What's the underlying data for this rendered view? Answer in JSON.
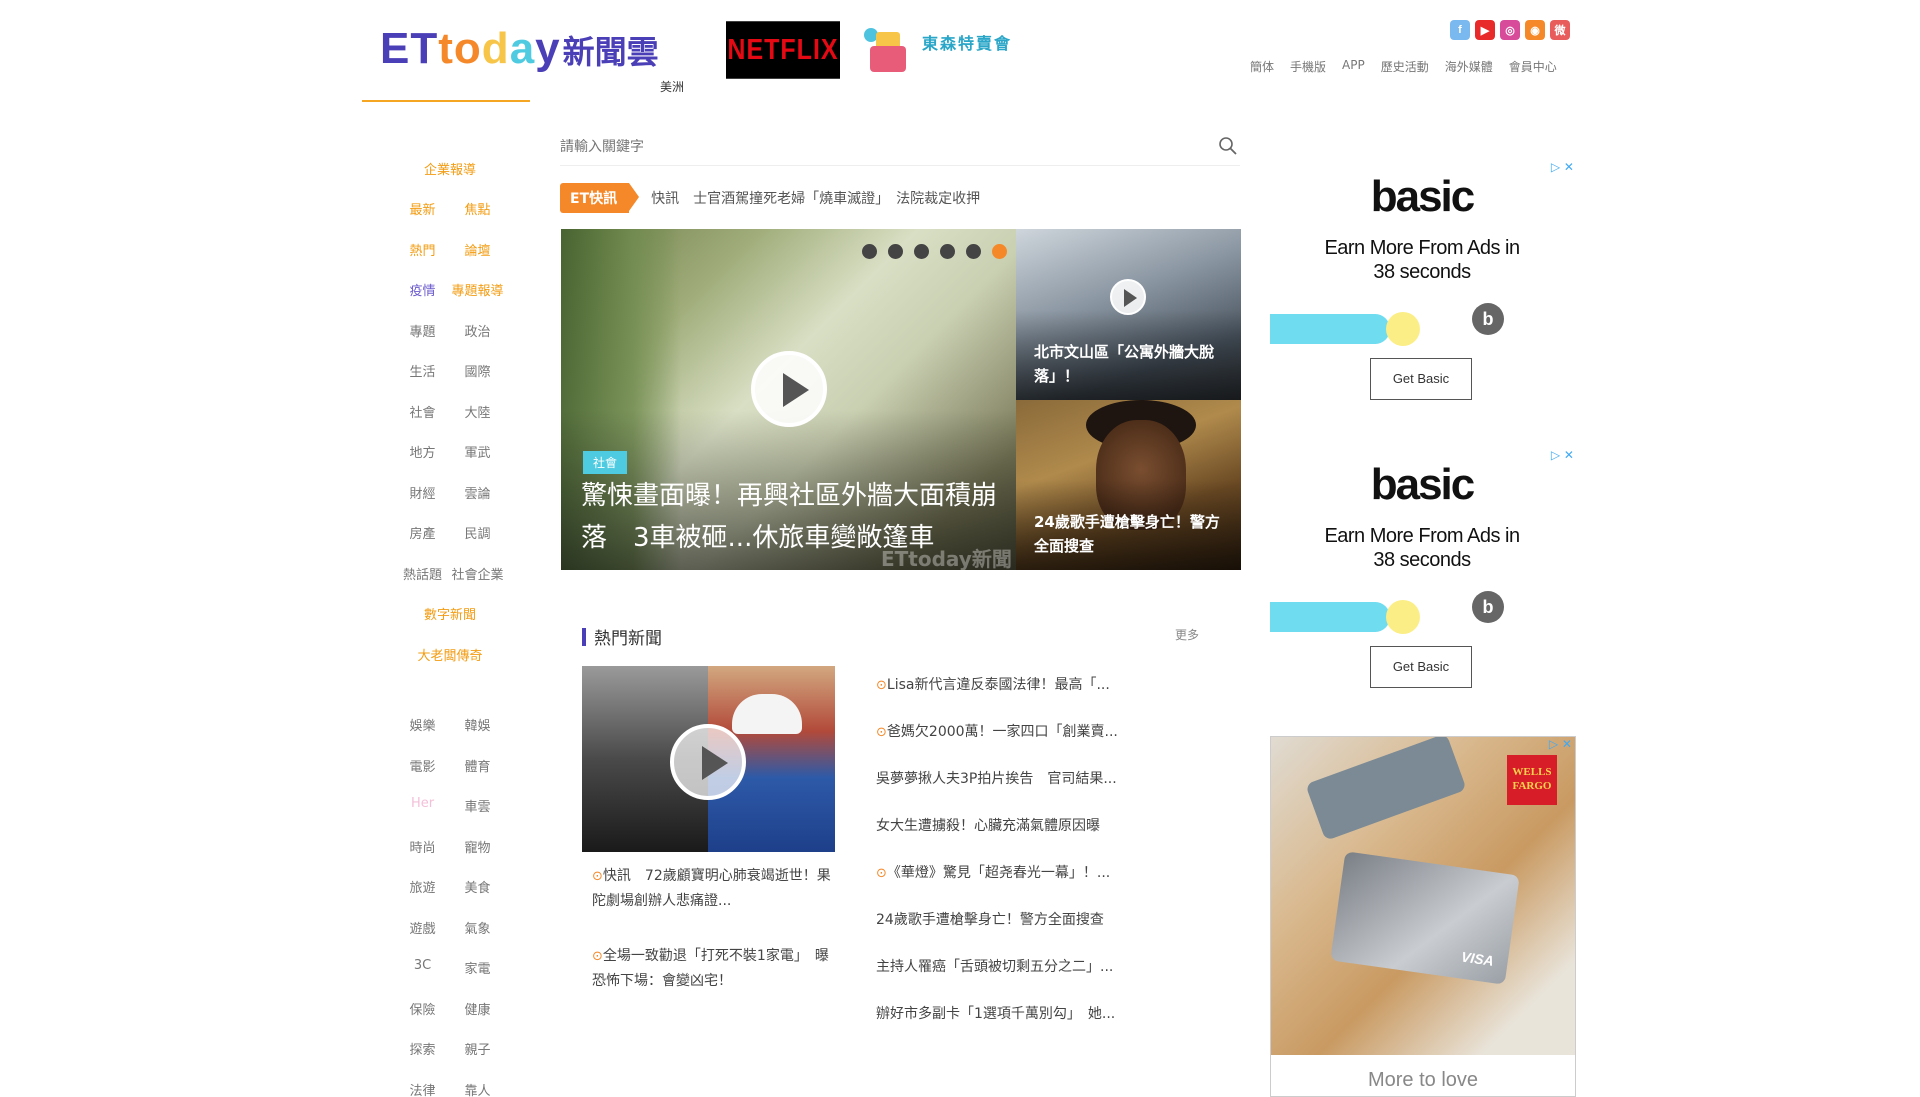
{
  "header": {
    "logo_letters": [
      {
        "ch": "E",
        "color": "#4b3fb8"
      },
      {
        "ch": "T",
        "color": "#4b3fb8"
      },
      {
        "ch": "t",
        "color": "#f5892a"
      },
      {
        "ch": "o",
        "color": "#f5892a"
      },
      {
        "ch": "d",
        "color": "#f7c548"
      },
      {
        "ch": "a",
        "color": "#4ecbe0"
      },
      {
        "ch": "y",
        "color": "#4b3fb8"
      }
    ],
    "logo_cn": "新聞雲",
    "region": "美洲",
    "netflix_label": "NETFLIX",
    "promo_text": "東森特賣會",
    "social": [
      {
        "icon": "facebook-icon",
        "glyph": "f",
        "color": "#7ab8f0"
      },
      {
        "icon": "youtube-icon",
        "glyph": "▶",
        "color": "#e82a2a"
      },
      {
        "icon": "instagram-icon",
        "glyph": "◎",
        "color": "#d84a9a"
      },
      {
        "icon": "rss-icon",
        "glyph": "◉",
        "color": "#f5892a"
      },
      {
        "icon": "weibo-icon",
        "glyph": "微",
        "color": "#e85c5c"
      }
    ],
    "topnav": [
      "簡体",
      "手機版",
      "APP",
      "歷史活動",
      "海外媒體",
      "會員中心"
    ]
  },
  "leftnav": {
    "rows_top": [
      {
        "single": "企業報導",
        "style": "orange"
      },
      {
        "pair": [
          "最新",
          "焦點"
        ],
        "style": "orange"
      },
      {
        "pair": [
          "熱門",
          "論壇"
        ],
        "style": "orange"
      },
      {
        "pair": [
          "疫情",
          "專題報導"
        ],
        "style": "purple-orange"
      },
      {
        "pair": [
          "專題",
          "政治"
        ],
        "style": ""
      },
      {
        "pair": [
          "生活",
          "國際"
        ],
        "style": ""
      },
      {
        "pair": [
          "社會",
          "大陸"
        ],
        "style": ""
      },
      {
        "pair": [
          "地方",
          "軍武"
        ],
        "style": ""
      },
      {
        "pair": [
          "財經",
          "雲論"
        ],
        "style": ""
      },
      {
        "pair": [
          "房產",
          "民調"
        ],
        "style": ""
      },
      {
        "pair": [
          "熱話題",
          "社會企業"
        ],
        "style": ""
      },
      {
        "single": "數字新聞",
        "style": "orange"
      },
      {
        "single": "大老闆傳奇",
        "style": "orange"
      }
    ],
    "rows_bottom": [
      {
        "pair": [
          "娛樂",
          "韓娛"
        ],
        "style": ""
      },
      {
        "pair": [
          "電影",
          "體育"
        ],
        "style": ""
      },
      {
        "pair": [
          "Her",
          "車雲"
        ],
        "style": "pink"
      },
      {
        "pair": [
          "時尚",
          "寵物"
        ],
        "style": ""
      },
      {
        "pair": [
          "旅遊",
          "美食"
        ],
        "style": ""
      },
      {
        "pair": [
          "遊戲",
          "氣象"
        ],
        "style": ""
      },
      {
        "pair": [
          "3C",
          "家電"
        ],
        "style": ""
      },
      {
        "pair": [
          "保險",
          "健康"
        ],
        "style": ""
      },
      {
        "pair": [
          "探索",
          "親子"
        ],
        "style": ""
      },
      {
        "pair": [
          "法律",
          "靠人"
        ],
        "style": ""
      }
    ]
  },
  "search": {
    "placeholder": "請輸入關鍵字"
  },
  "ticker": {
    "badge": "ET快訊",
    "text": "快訊　士官酒駕撞死老婦「燒車滅證」　法院裁定收押"
  },
  "hero": {
    "main": {
      "tag": "社會",
      "title": "驚悚畫面曝！再興社區外牆大面積崩落　3車被砸...休旅車變敞篷車",
      "watermark": "ETtoday新聞"
    },
    "dots": 6,
    "active_dot": 5,
    "side1_title": "北市文山區「公寓外牆大脫落」！",
    "side2_title": "24歲歌手遭槍擊身亡！警方全面搜查"
  },
  "hot": {
    "title": "熱門新聞",
    "more": "更多",
    "caption1_prefix": "快訊　",
    "caption1": "72歲顧寶明心肺衰竭逝世！果陀劇場創辦人悲痛證...",
    "caption2": "全場一致勸退「打死不裝1家電」　曝恐怖下場：會變凶宅！",
    "list": [
      {
        "video": true,
        "text": "Lisa新代言違反泰國法律！最高「..."
      },
      {
        "video": true,
        "text": "爸媽欠2000萬！一家四口「創業賣..."
      },
      {
        "video": false,
        "text": "吳夢夢揪人夫3P拍片挨告　官司結果..."
      },
      {
        "video": false,
        "text": "女大生遭擄殺！心臟充滿氣體原因曝"
      },
      {
        "video": true,
        "text": "《華燈》驚見「超尧春光一幕」！..."
      },
      {
        "video": false,
        "text": "24歲歌手遭槍擊身亡！警方全面搜查"
      },
      {
        "video": false,
        "text": "主持人罹癌「舌頭被切剩五分之二」..."
      },
      {
        "video": false,
        "text": "辦好市多副卡「1選項千萬別勾」　她..."
      }
    ]
  },
  "ads": {
    "adchoice": "▷ ✕",
    "basic": {
      "brand": "basic",
      "tag_line1": "Earn More From Ads in",
      "tag_line2": "38 seconds",
      "b_icon": "b",
      "button": "Get Basic"
    },
    "wells": {
      "logo": "WELLS FARGO",
      "card_text": "VISA",
      "footer": "More to love"
    }
  }
}
